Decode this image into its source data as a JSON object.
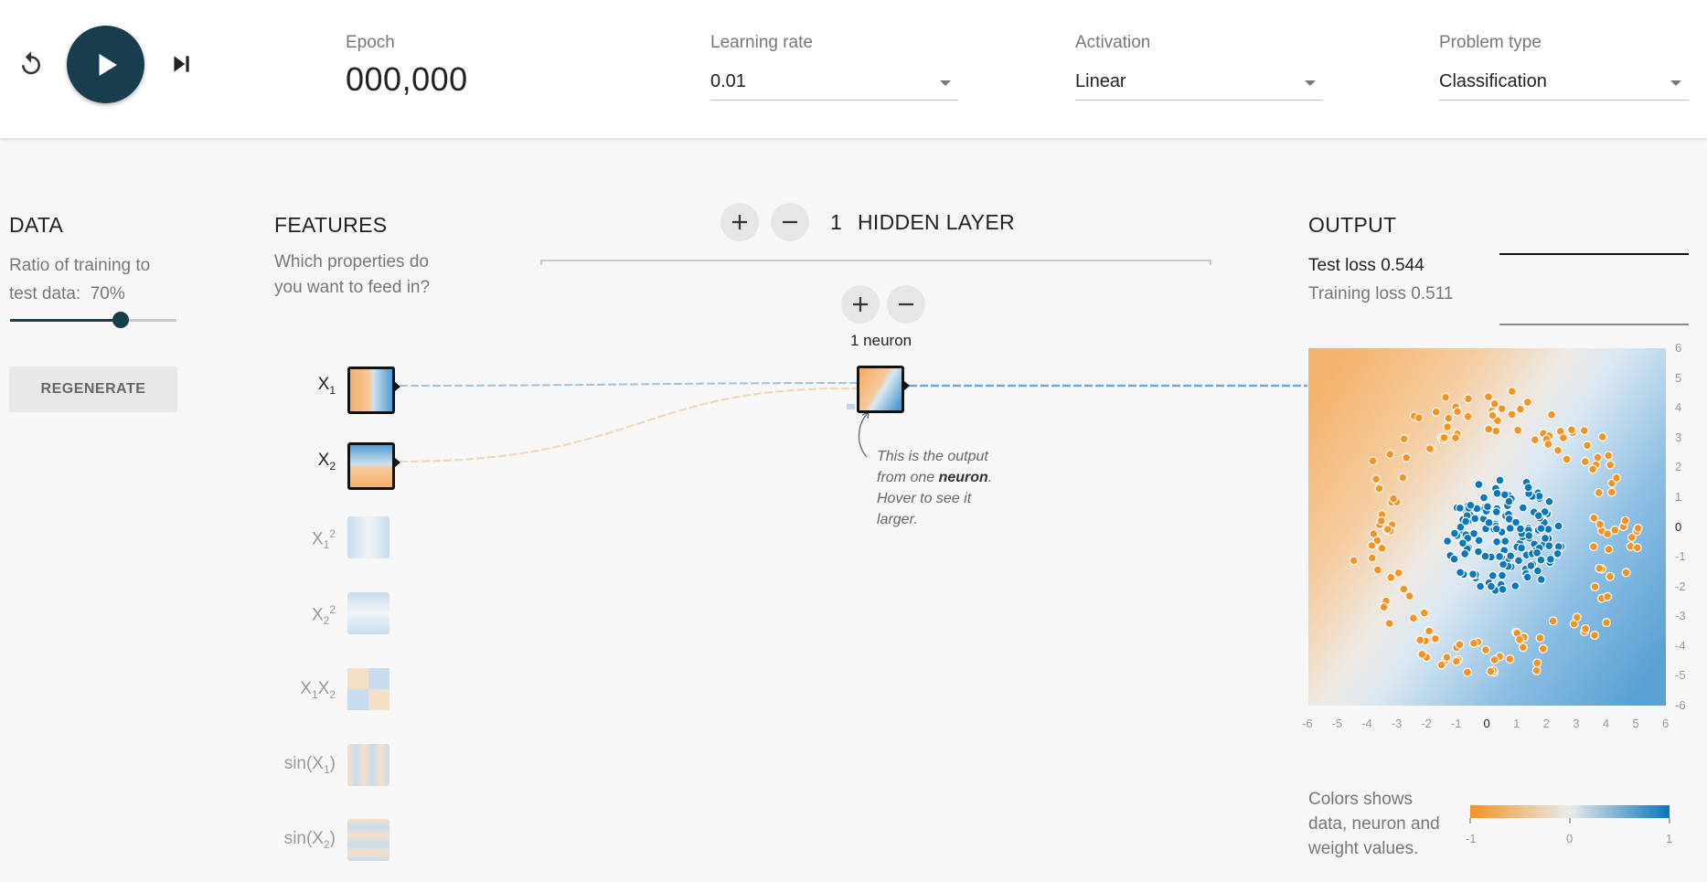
{
  "controls": {
    "reset_icon": "reset-icon",
    "play_icon": "play-icon",
    "step_icon": "step-icon"
  },
  "epoch": {
    "label": "Epoch",
    "value": "000,000"
  },
  "learning_rate": {
    "label": "Learning rate",
    "value": "0.01"
  },
  "activation": {
    "label": "Activation",
    "value": "Linear"
  },
  "problem_type": {
    "label": "Problem type",
    "value": "Classification"
  },
  "data_panel": {
    "heading": "DATA",
    "ratio_label_1": "Ratio of training to",
    "ratio_label_2": "test data:",
    "ratio_value": "70%",
    "ratio": 0.7,
    "regenerate": "REGENERATE"
  },
  "features_panel": {
    "heading": "FEATURES",
    "sub_1": "Which properties do",
    "sub_2": "you want to feed in?"
  },
  "network": {
    "layer_count": "1",
    "layer_label": "HIDDEN LAYER",
    "neuron_count_label": "1 neuron",
    "callout_1": "This is the output",
    "callout_2a": "from one ",
    "callout_2b": "neuron",
    "callout_2c": ".",
    "callout_3": "Hover to see it",
    "callout_4": "larger."
  },
  "output_panel": {
    "heading": "OUTPUT",
    "test_loss_label": "Test loss",
    "test_loss": "0.544",
    "training_loss_label": "Training loss",
    "training_loss": "0.511",
    "x_ticks": [
      "-6",
      "-5",
      "-4",
      "-3",
      "-2",
      "-1",
      "0",
      "1",
      "2",
      "3",
      "4",
      "5",
      "6"
    ],
    "y_ticks": [
      "6",
      "5",
      "4",
      "3",
      "2",
      "1",
      "0",
      "-1",
      "-2",
      "-3",
      "-4",
      "-5",
      "-6"
    ],
    "legend_1": "Colors shows",
    "legend_2": "data, neuron and",
    "legend_3": "weight values.",
    "scale_ticks": [
      "-1",
      "0",
      "1"
    ]
  },
  "colors": {
    "orange": "#f59322",
    "blue": "#0877bd",
    "dark": "#183d4e"
  }
}
